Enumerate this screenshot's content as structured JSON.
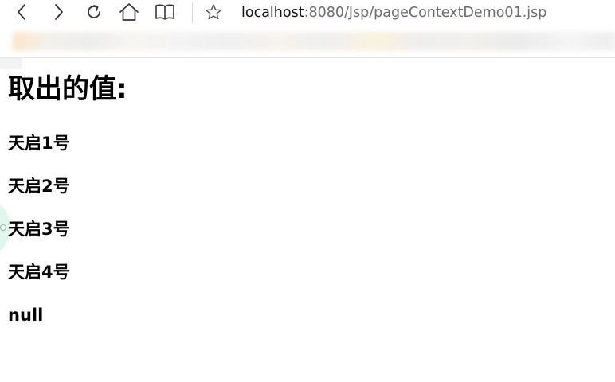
{
  "browser": {
    "address": {
      "host": "localhost",
      "path": ":8080/Jsp/pageContextDemo01.jsp"
    },
    "icons": [
      "back-icon",
      "forward-icon",
      "refresh-icon",
      "home-icon",
      "reading-view-icon",
      "favorite-star-icon"
    ]
  },
  "page": {
    "heading": "取出的值:",
    "values": [
      "天启1号",
      "天启2号",
      "天启3号",
      "天启4号",
      "null"
    ]
  }
}
